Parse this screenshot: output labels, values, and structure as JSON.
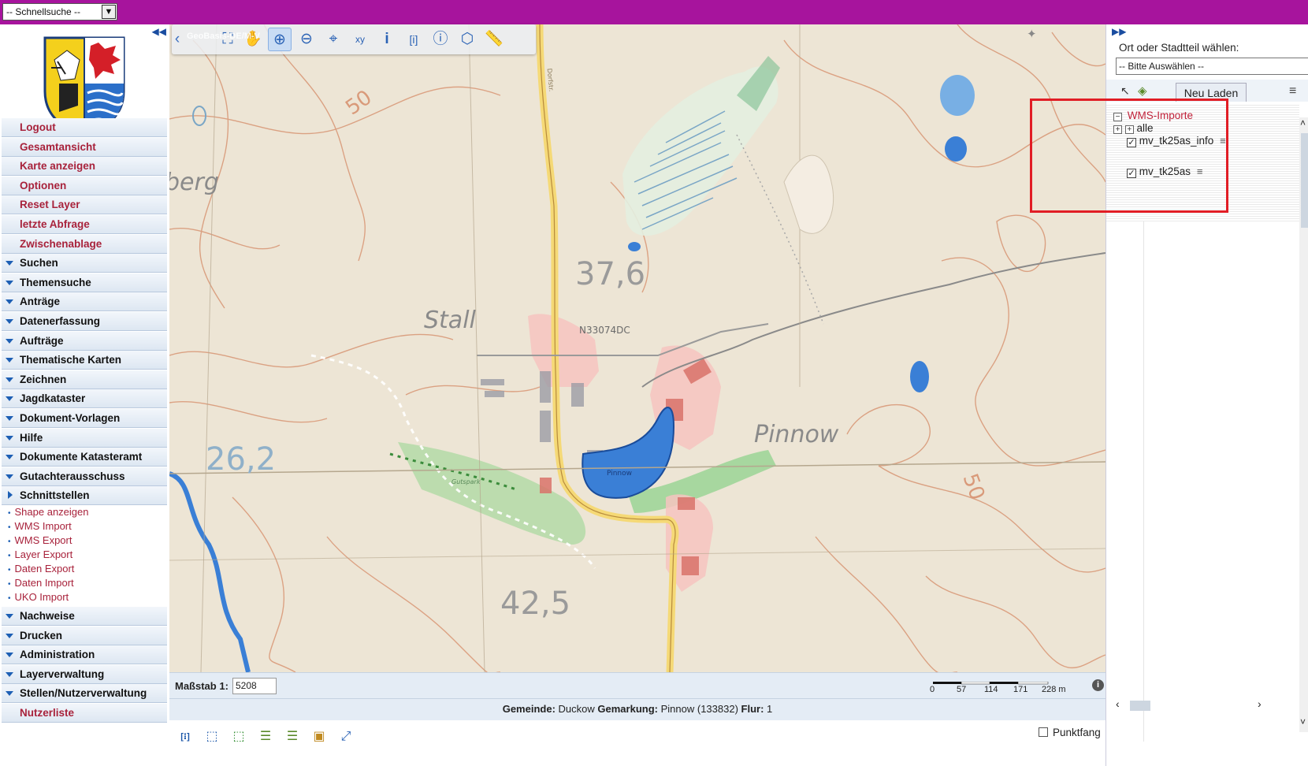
{
  "topbar": {
    "quicksearch": "-- Schnellsuche --"
  },
  "menu": {
    "links": [
      "Logout",
      "Gesamtansicht",
      "Karte anzeigen",
      "Optionen",
      "Reset Layer",
      "letzte Abfrage",
      "Zwischenablage"
    ],
    "groups_top": [
      "Suchen",
      "Themensuche",
      "Anträge",
      "Datenerfassung",
      "Aufträge",
      "Thematische Karten",
      "Zeichnen",
      "Jagdkataster",
      "Dokument-Vorlagen",
      "Hilfe",
      "Dokumente Katasteramt",
      "Gutachterausschuss"
    ],
    "schnittstellen": "Schnittstellen",
    "schnittstellen_items": [
      "Shape anzeigen",
      "WMS Import",
      "WMS Export",
      "Layer Export",
      "Daten Export",
      "Daten Import",
      "UKO Import"
    ],
    "groups_bottom": [
      "Nachweise",
      "Drucken",
      "Administration",
      "Layerverwaltung",
      "Stellen/Nutzerverwaltung"
    ],
    "last_link": "Nutzerliste"
  },
  "map": {
    "copyright": "GeoBasis-DE/M-V",
    "labels": {
      "stall": "Stall",
      "pinnow": "Pinnow",
      "pinnow_lake": "Pinnow",
      "gutspark": "Gutspark",
      "elev_376": "37,6",
      "elev_262": "26,2",
      "elev_425": "42,5",
      "contour_50_a": "50",
      "contour_50_b": "50",
      "berg": "berg",
      "grid_code": "N33074DC",
      "dorfstr": "Dorfstr."
    }
  },
  "scalebar": {
    "label": "Maßstab 1:",
    "value": "5208",
    "ticks": [
      "0",
      "57",
      "114",
      "171",
      "228 m"
    ]
  },
  "location": {
    "gemeinde_label": "Gemeinde:",
    "gemeinde": "Duckow",
    "gemarkung_label": "Gemarkung:",
    "gemarkung": "Pinnow (133832)",
    "flur_label": "Flur:",
    "flur": "1"
  },
  "bottom": {
    "punktfang": "Punktfang"
  },
  "rightpanel": {
    "ort_label": "Ort oder Stadtteil wählen:",
    "ort_select": "-- Bitte Auswählen --",
    "neu_laden": "Neu Laden",
    "tree": {
      "group": "WMS-Importe",
      "alle": "alle",
      "layer1": "mv_tk25as_info",
      "layer2": "mv_tk25as"
    }
  },
  "colors": {
    "topbar": "#a7149d",
    "menu_link": "#a8223b",
    "highlight": "#e11d25"
  }
}
